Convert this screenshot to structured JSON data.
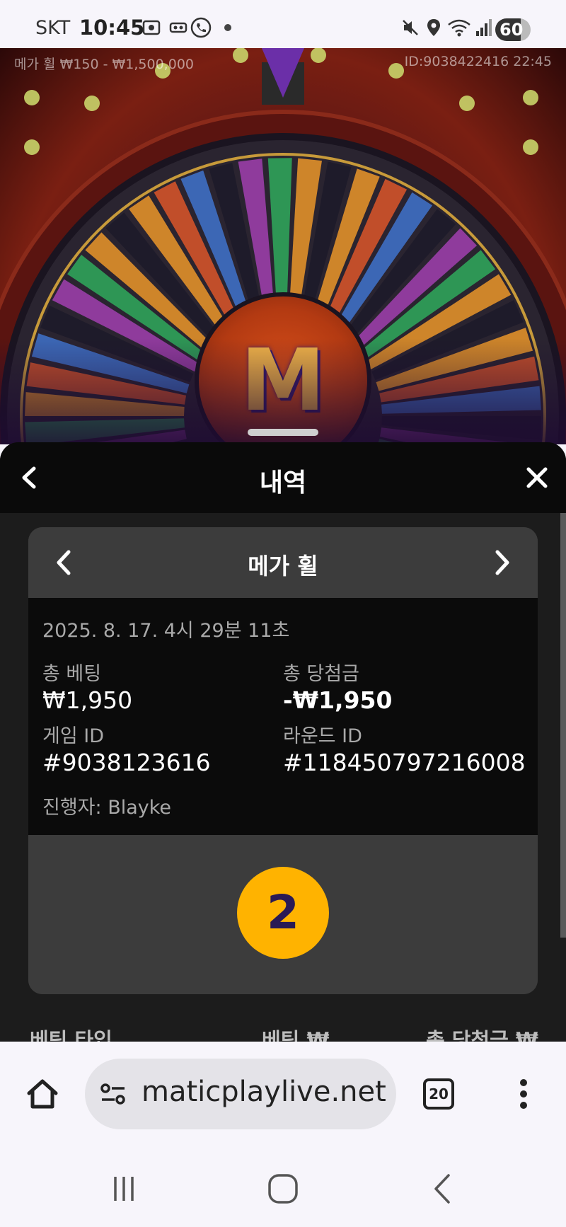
{
  "status_bar": {
    "carrier": "SKT",
    "time": "10:45",
    "battery": "60",
    "left_icons": [
      "screenshot-icon",
      "voicemail-icon",
      "call-icon",
      "dot-icon"
    ],
    "right_icons": [
      "mute-icon",
      "location-icon",
      "wifi-icon",
      "signal-icon"
    ]
  },
  "game": {
    "info_left": "메가 휠 ₩150 - ₩1,500,000",
    "info_right": "ID:9038422416  22:45",
    "logo_letter": "M"
  },
  "panel": {
    "title": "내역",
    "back_icon": "chevron-left-icon",
    "close_icon": "close-icon"
  },
  "card": {
    "game_name": "메가 휠",
    "date": "2025. 8. 17. 4시 29분 11초",
    "total_bet_label": "총 베팅",
    "total_bet_value": "₩1,950",
    "total_win_label": "총 당첨금",
    "total_win_value": "-₩1,950",
    "game_id_label": "게임 ID",
    "game_id_value": "#9038123616",
    "round_id_label": "라운드 ID",
    "round_id_value": "#118450797216008",
    "dealer": "진행자: Blayke",
    "result": "2",
    "result_color": "#ffb300"
  },
  "table_headers": [
    "베팅 타입",
    "베팅 ₩",
    "총 당첨금 ₩"
  ],
  "browser": {
    "url": "maticplaylive.net",
    "tab_count": "20"
  }
}
